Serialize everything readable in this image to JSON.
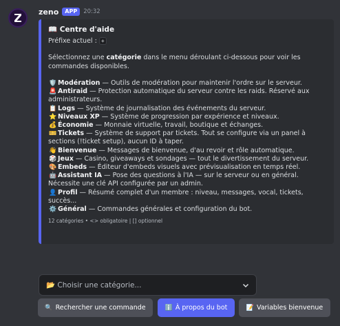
{
  "message": {
    "username": "zeno",
    "badge": "APP",
    "timestamp": "20:32"
  },
  "embed": {
    "title_icon": "📖",
    "title": "Centre d'aide",
    "prefix_label": "Préfixe actuel :",
    "prefix_value": "+",
    "intro_before": "Sélectionnez une ",
    "intro_bold": "catégorie",
    "intro_after": " dans le menu déroulant ci-dessous pour voir les",
    "intro_line2": "commandes disponibles.",
    "categories": [
      {
        "icon": "🛡️",
        "name": "Modération",
        "desc": " — Outils de modération pour maintenir l'ordre sur le serveur.",
        "cont": ""
      },
      {
        "icon": "🚨",
        "name": "Antiraid",
        "desc": " — Protection automatique du serveur contre les raids. Réservé aux",
        "cont": "administrateurs."
      },
      {
        "icon": "📋",
        "name": "Logs",
        "desc": " — Système de journalisation des événements du serveur.",
        "cont": ""
      },
      {
        "icon": "⭐",
        "name": "Niveaux XP",
        "desc": " — Système de progression par expérience et niveaux.",
        "cont": ""
      },
      {
        "icon": "💰",
        "name": "Économie",
        "desc": " — Monnaie virtuelle, travail, boutique et échanges.",
        "cont": ""
      },
      {
        "icon": "🎫",
        "name": "Tickets",
        "desc": " — Système de support par tickets. Tout se configure via un panel à",
        "cont": "sections (!ticket setup), aucun ID à taper."
      },
      {
        "icon": "👋",
        "name": "Bienvenue",
        "desc": " — Messages de bienvenue, d'au revoir et rôle automatique.",
        "cont": ""
      },
      {
        "icon": "🎲",
        "name": "Jeux",
        "desc": " — Casino, giveaways et sondages — tout le divertissement du serveur.",
        "cont": ""
      },
      {
        "icon": "🎨",
        "name": "Embeds",
        "desc": " — Éditeur d'embeds visuels avec prévisualisation en temps réel.",
        "cont": ""
      },
      {
        "icon": "🤖",
        "name": "Assistant IA",
        "desc": " — Pose des questions à l'IA — sur le serveur ou en général.",
        "cont": "Nécessite une clé API configurée par un admin."
      },
      {
        "icon": "👤",
        "name": "Profil",
        "desc": " — Résumé complet d'un membre : niveau, messages, vocal, tickets,",
        "cont": "succès..."
      },
      {
        "icon": "⚙️",
        "name": "Général",
        "desc": " — Commandes générales et configuration du bot.",
        "cont": ""
      }
    ],
    "footer": "12 catégories • <> obligatoire | [] optionnel"
  },
  "select": {
    "icon": "📂",
    "placeholder": "Choisir une catégorie..."
  },
  "buttons": [
    {
      "icon": "🔍",
      "label": "Rechercher une commande",
      "style": "secondary"
    },
    {
      "icon": "ℹ️",
      "label": "À propos du bot",
      "style": "primary"
    },
    {
      "icon": "📝",
      "label": "Variables bienvenue",
      "style": "secondary"
    }
  ],
  "colors": {
    "background": "#313338",
    "embed_background": "#2b2d31",
    "embed_accent": "#5865f2",
    "primary_button": "#5865f2",
    "secondary_button": "#4e5058"
  }
}
